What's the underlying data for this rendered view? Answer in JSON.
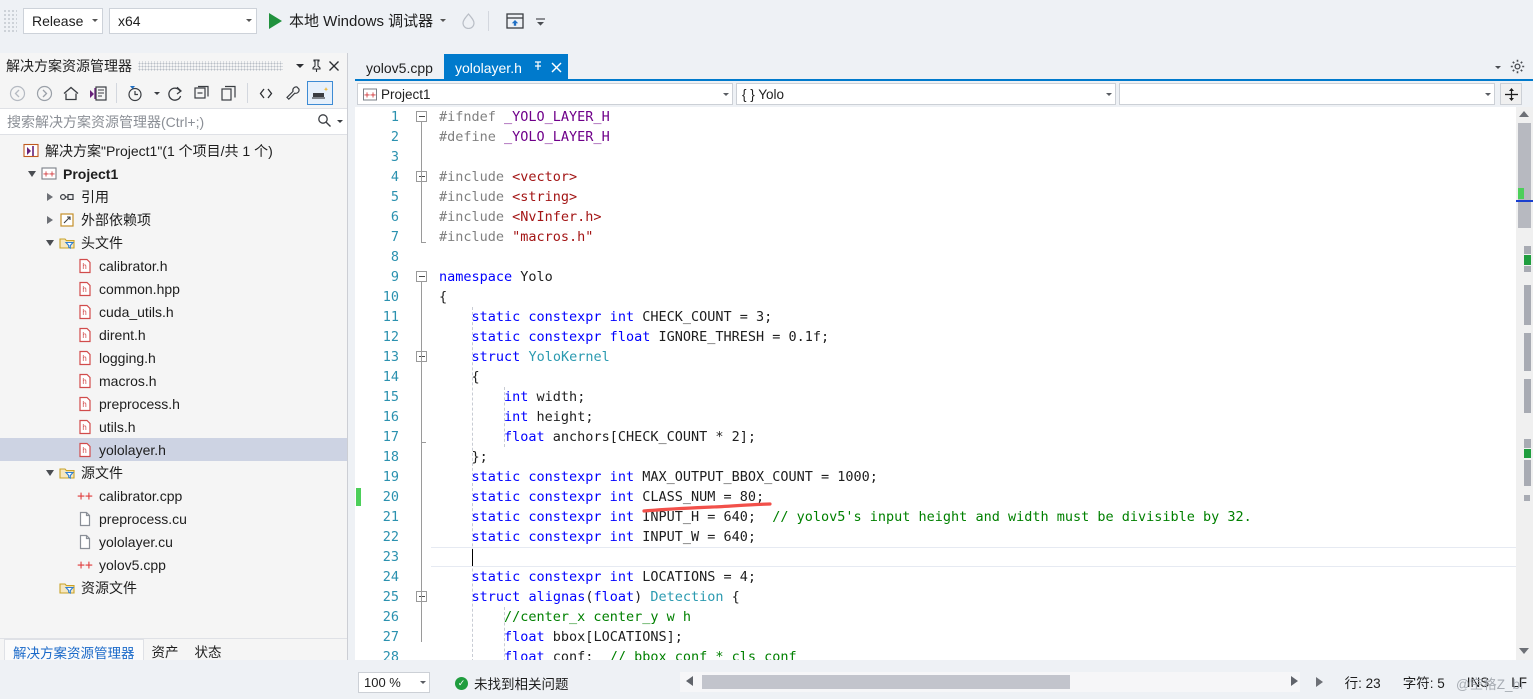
{
  "toolbar": {
    "configuration": "Release",
    "platform": "x64",
    "run_label": "本地 Windows 调试器",
    "icons": [
      "play-icon",
      "hot-reload-icon",
      "window-layout-icon",
      "overflow-icon"
    ]
  },
  "solution_explorer": {
    "title": "解决方案资源管理器",
    "search_placeholder": "搜索解决方案资源管理器(Ctrl+;)",
    "toolbar_icons": [
      "back-icon",
      "forward-icon",
      "home-icon",
      "sync-with-active-document-icon",
      "pending-changes-icon",
      "refresh-icon",
      "collapse-all-icon",
      "copy-icon",
      "show-all-files-icon",
      "properties-icon",
      "preview-selected-items-icon"
    ],
    "tree": [
      {
        "label": "解决方案\"Project1\"(1 个项目/共 1 个)",
        "icon": "solution-icon",
        "indent": 0,
        "expander": "none",
        "bold": false,
        "selected": false
      },
      {
        "label": "Project1",
        "icon": "cpp-project-icon",
        "indent": 1,
        "expander": "down",
        "bold": true,
        "selected": false
      },
      {
        "label": "引用",
        "icon": "references-icon",
        "indent": 2,
        "expander": "right",
        "bold": false,
        "selected": false
      },
      {
        "label": "外部依赖项",
        "icon": "external-dependencies-icon",
        "indent": 2,
        "expander": "right",
        "bold": false,
        "selected": false
      },
      {
        "label": "头文件",
        "icon": "filter-folder-icon",
        "indent": 2,
        "expander": "down",
        "bold": false,
        "selected": false
      },
      {
        "label": "calibrator.h",
        "icon": "header-file-icon",
        "indent": 3,
        "expander": "none",
        "bold": false,
        "selected": false
      },
      {
        "label": "common.hpp",
        "icon": "header-file-icon",
        "indent": 3,
        "expander": "none",
        "bold": false,
        "selected": false
      },
      {
        "label": "cuda_utils.h",
        "icon": "header-file-icon",
        "indent": 3,
        "expander": "none",
        "bold": false,
        "selected": false
      },
      {
        "label": "dirent.h",
        "icon": "header-file-icon",
        "indent": 3,
        "expander": "none",
        "bold": false,
        "selected": false
      },
      {
        "label": "logging.h",
        "icon": "header-file-icon",
        "indent": 3,
        "expander": "none",
        "bold": false,
        "selected": false
      },
      {
        "label": "macros.h",
        "icon": "header-file-icon",
        "indent": 3,
        "expander": "none",
        "bold": false,
        "selected": false
      },
      {
        "label": "preprocess.h",
        "icon": "header-file-icon",
        "indent": 3,
        "expander": "none",
        "bold": false,
        "selected": false
      },
      {
        "label": "utils.h",
        "icon": "header-file-icon",
        "indent": 3,
        "expander": "none",
        "bold": false,
        "selected": false
      },
      {
        "label": "yololayer.h",
        "icon": "header-file-icon",
        "indent": 3,
        "expander": "none",
        "bold": false,
        "selected": true
      },
      {
        "label": "源文件",
        "icon": "filter-folder-icon",
        "indent": 2,
        "expander": "down",
        "bold": false,
        "selected": false
      },
      {
        "label": "calibrator.cpp",
        "icon": "cpp-file-icon",
        "indent": 3,
        "expander": "none",
        "bold": false,
        "selected": false
      },
      {
        "label": "preprocess.cu",
        "icon": "plain-file-icon",
        "indent": 3,
        "expander": "none",
        "bold": false,
        "selected": false
      },
      {
        "label": "yololayer.cu",
        "icon": "plain-file-icon",
        "indent": 3,
        "expander": "none",
        "bold": false,
        "selected": false
      },
      {
        "label": "yolov5.cpp",
        "icon": "cpp-file-icon",
        "indent": 3,
        "expander": "none",
        "bold": false,
        "selected": false
      },
      {
        "label": "资源文件",
        "icon": "filter-folder-icon",
        "indent": 2,
        "expander": "none",
        "bold": false,
        "selected": false
      }
    ],
    "bottom_tabs": [
      {
        "label": "解决方案资源管理器",
        "active": true
      },
      {
        "label": "资产",
        "active": false
      },
      {
        "label": "状态",
        "active": false
      }
    ]
  },
  "editor": {
    "tabs": [
      {
        "label": "yolov5.cpp",
        "active": false
      },
      {
        "label": "yololayer.h",
        "active": true,
        "pin_icon": "pin-icon",
        "close_icon": "close-icon"
      }
    ],
    "nav": {
      "project": "Project1",
      "project_icon": "cpp-project-icon",
      "scope": "{ } Yolo",
      "member": "",
      "split_icon": "split-window-icon"
    },
    "lines": [
      {
        "n": 1,
        "fold": "minus",
        "tokens": [
          {
            "t": "#ifndef ",
            "c": "pp"
          },
          {
            "t": "_YOLO_LAYER_H",
            "c": "mac"
          }
        ]
      },
      {
        "n": 2,
        "fold": "",
        "tokens": [
          {
            "t": "#define ",
            "c": "pp"
          },
          {
            "t": "_YOLO_LAYER_H",
            "c": "mac"
          }
        ]
      },
      {
        "n": 3,
        "fold": "",
        "tokens": []
      },
      {
        "n": 4,
        "fold": "minus",
        "tokens": [
          {
            "t": "#include ",
            "c": "pp"
          },
          {
            "t": "<vector>",
            "c": "str"
          }
        ]
      },
      {
        "n": 5,
        "fold": "",
        "tokens": [
          {
            "t": "#include ",
            "c": "pp"
          },
          {
            "t": "<string>",
            "c": "str"
          }
        ]
      },
      {
        "n": 6,
        "fold": "",
        "tokens": [
          {
            "t": "#include ",
            "c": "pp"
          },
          {
            "t": "<NvInfer.h>",
            "c": "str"
          }
        ]
      },
      {
        "n": 7,
        "fold": "",
        "tokens": [
          {
            "t": "#include ",
            "c": "pp"
          },
          {
            "t": "\"macros.h\"",
            "c": "str"
          }
        ]
      },
      {
        "n": 8,
        "fold": "",
        "tokens": []
      },
      {
        "n": 9,
        "fold": "minus",
        "tokens": [
          {
            "t": "namespace",
            "c": "kw"
          },
          {
            "t": " Yolo",
            "c": ""
          }
        ]
      },
      {
        "n": 10,
        "fold": "",
        "tokens": [
          {
            "t": "{",
            "c": ""
          }
        ]
      },
      {
        "n": 11,
        "fold": "",
        "tokens": [
          {
            "t": "    ",
            "c": ""
          },
          {
            "t": "static constexpr int",
            "c": "kw"
          },
          {
            "t": " CHECK_COUNT = 3;",
            "c": ""
          }
        ]
      },
      {
        "n": 12,
        "fold": "",
        "tokens": [
          {
            "t": "    ",
            "c": ""
          },
          {
            "t": "static constexpr float",
            "c": "kw"
          },
          {
            "t": " IGNORE_THRESH = 0.1f;",
            "c": ""
          }
        ]
      },
      {
        "n": 13,
        "fold": "minus",
        "tokens": [
          {
            "t": "    ",
            "c": ""
          },
          {
            "t": "struct",
            "c": "kw"
          },
          {
            "t": " ",
            "c": ""
          },
          {
            "t": "YoloKernel",
            "c": "ty"
          }
        ]
      },
      {
        "n": 14,
        "fold": "",
        "tokens": [
          {
            "t": "    {",
            "c": ""
          }
        ]
      },
      {
        "n": 15,
        "fold": "",
        "tokens": [
          {
            "t": "        ",
            "c": ""
          },
          {
            "t": "int",
            "c": "kw"
          },
          {
            "t": " width;",
            "c": ""
          }
        ]
      },
      {
        "n": 16,
        "fold": "",
        "tokens": [
          {
            "t": "        ",
            "c": ""
          },
          {
            "t": "int",
            "c": "kw"
          },
          {
            "t": " height;",
            "c": ""
          }
        ]
      },
      {
        "n": 17,
        "fold": "",
        "tokens": [
          {
            "t": "        ",
            "c": ""
          },
          {
            "t": "float",
            "c": "kw"
          },
          {
            "t": " anchors[CHECK_COUNT * 2];",
            "c": ""
          }
        ]
      },
      {
        "n": 18,
        "fold": "",
        "tokens": [
          {
            "t": "    };",
            "c": ""
          }
        ]
      },
      {
        "n": 19,
        "fold": "",
        "tokens": [
          {
            "t": "    ",
            "c": ""
          },
          {
            "t": "static constexpr int",
            "c": "kw"
          },
          {
            "t": " MAX_OUTPUT_BBOX_COUNT = 1000;",
            "c": ""
          }
        ]
      },
      {
        "n": 20,
        "fold": "",
        "changed": true,
        "tokens": [
          {
            "t": "    ",
            "c": ""
          },
          {
            "t": "static constexpr int",
            "c": "kw"
          },
          {
            "t": " CLASS_NUM = 80;",
            "c": ""
          }
        ]
      },
      {
        "n": 21,
        "fold": "",
        "tokens": [
          {
            "t": "    ",
            "c": ""
          },
          {
            "t": "static constexpr int",
            "c": "kw"
          },
          {
            "t": " INPUT_H = 640;  ",
            "c": ""
          },
          {
            "t": "// yolov5's input height and width must be divisible by 32.",
            "c": "cm"
          }
        ]
      },
      {
        "n": 22,
        "fold": "",
        "tokens": [
          {
            "t": "    ",
            "c": ""
          },
          {
            "t": "static constexpr int",
            "c": "kw"
          },
          {
            "t": " INPUT_W = 640;",
            "c": ""
          }
        ]
      },
      {
        "n": 23,
        "fold": "",
        "current": true,
        "tokens": []
      },
      {
        "n": 24,
        "fold": "",
        "tokens": [
          {
            "t": "    ",
            "c": ""
          },
          {
            "t": "static constexpr int",
            "c": "kw"
          },
          {
            "t": " LOCATIONS = 4;",
            "c": ""
          }
        ]
      },
      {
        "n": 25,
        "fold": "minus",
        "tokens": [
          {
            "t": "    ",
            "c": ""
          },
          {
            "t": "struct",
            "c": "kw"
          },
          {
            "t": " ",
            "c": ""
          },
          {
            "t": "alignas",
            "c": "kw"
          },
          {
            "t": "(",
            "c": ""
          },
          {
            "t": "float",
            "c": "kw"
          },
          {
            "t": ") ",
            "c": ""
          },
          {
            "t": "Detection",
            "c": "ty"
          },
          {
            "t": " {",
            "c": ""
          }
        ]
      },
      {
        "n": 26,
        "fold": "",
        "tokens": [
          {
            "t": "        ",
            "c": ""
          },
          {
            "t": "//center_x center_y w h",
            "c": "cm"
          }
        ]
      },
      {
        "n": 27,
        "fold": "",
        "tokens": [
          {
            "t": "        ",
            "c": ""
          },
          {
            "t": "float",
            "c": "kw"
          },
          {
            "t": " bbox[LOCATIONS];",
            "c": ""
          }
        ]
      },
      {
        "n": 28,
        "fold": "",
        "tokens": [
          {
            "t": "        ",
            "c": ""
          },
          {
            "t": "float",
            "c": "kw"
          },
          {
            "t": " conf;  ",
            "c": ""
          },
          {
            "t": "// bbox_conf * cls_conf",
            "c": "cm"
          }
        ]
      }
    ],
    "annotation": {
      "type": "red-underline",
      "target": "CLASS_NUM = 80",
      "color": "#f2504a"
    }
  },
  "status": {
    "zoom": "100 %",
    "problem_icon": "ok-check-icon",
    "problem_text": "未找到相关问题",
    "line_label": "行: 23",
    "char_label": "字符: 5",
    "ins_label": "INS",
    "eol_label": "LF",
    "watermark": "@空格Z_bi"
  },
  "colors": {
    "accent": "#007acc",
    "chrome": "#eef1f5",
    "selection": "#cdd3e3",
    "change_green": "#4ccf5a",
    "keyword_blue": "#0000ff",
    "comment_green": "#008000",
    "string_red": "#a31515",
    "macro_purple": "#6f008a",
    "type_teal": "#2b9ab0",
    "linenum_teal": "#2b91af"
  }
}
